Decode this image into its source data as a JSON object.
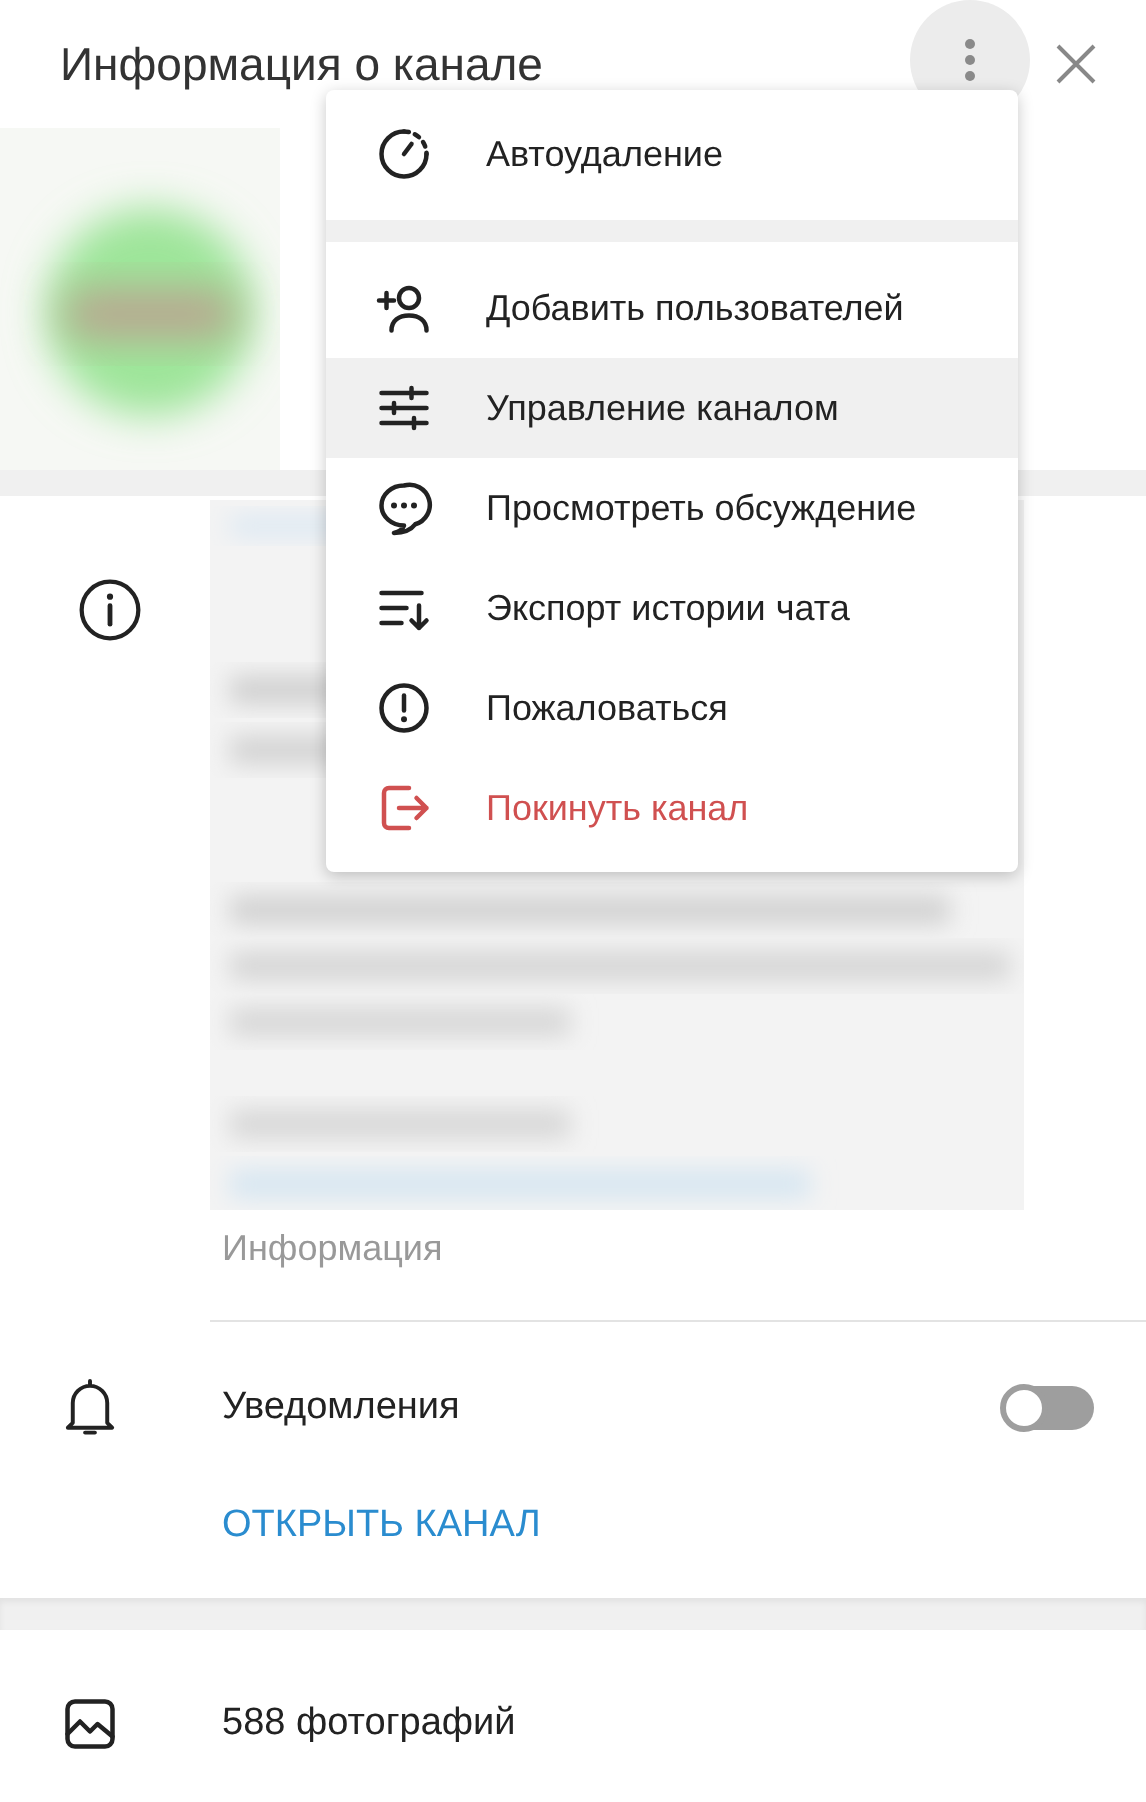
{
  "header": {
    "title": "Информация о канале"
  },
  "menu": {
    "groups": [
      [
        {
          "label": "Автоудаление",
          "selected": false,
          "kind": "normal"
        }
      ],
      [
        {
          "label": "Добавить пользователей",
          "selected": false,
          "kind": "normal"
        },
        {
          "label": "Управление каналом",
          "selected": true,
          "kind": "normal"
        },
        {
          "label": "Просмотреть обсуждение",
          "selected": false,
          "kind": "normal"
        },
        {
          "label": "Экспорт истории чата",
          "selected": false,
          "kind": "normal"
        },
        {
          "label": "Пожаловаться",
          "selected": false,
          "kind": "normal"
        },
        {
          "label": "Покинуть канал",
          "selected": false,
          "kind": "danger"
        }
      ]
    ]
  },
  "info": {
    "caption": "Информация"
  },
  "notifications": {
    "label": "Уведомления",
    "on": false
  },
  "open_button": "ОТКРЫТЬ КАНАЛ",
  "media": {
    "label": "588 фотографий"
  }
}
